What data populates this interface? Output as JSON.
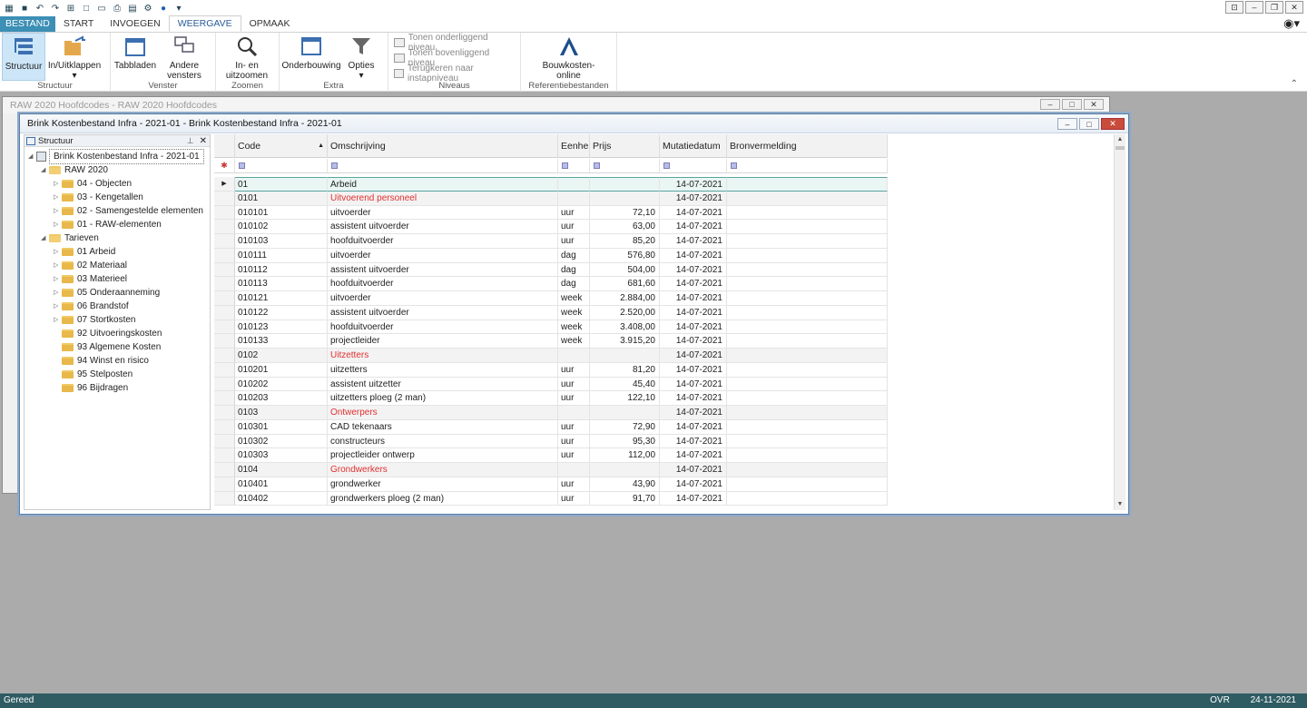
{
  "tabs": {
    "file": "BESTAND",
    "items": [
      "START",
      "INVOEGEN",
      "WEERGAVE",
      "OPMAAK"
    ],
    "active": "WEERGAVE"
  },
  "ribbon": {
    "groups": {
      "structuur": "Structuur",
      "venster": "Venster",
      "zoomen": "Zoomen",
      "extra": "Extra",
      "niveaus": "Niveaus",
      "referentie": "Referentiebestanden"
    },
    "buttons": {
      "structuur": "Structuur",
      "inuitklappen": "In/Uitklappen",
      "tabbladen": "Tabbladen",
      "andere_vensters": "Andere vensters",
      "in_uitzoomen": "In- en uitzoomen",
      "onderbouwing": "Onderbouwing",
      "opties": "Opties",
      "tonen_onder": "Tonen onderliggend niveau",
      "tonen_boven": "Tonen bovenliggend niveau",
      "terugkeren": "Terugkeren naar instapniveau",
      "bouwkosten": "Bouwkosten-online"
    }
  },
  "backwin": {
    "title": "RAW 2020 Hoofdcodes - RAW 2020 Hoofdcodes"
  },
  "frontwin": {
    "title": "Brink Kostenbestand Infra - 2021-01 - Brink Kostenbestand Infra - 2021-01"
  },
  "tree": {
    "header": "Structuur",
    "root": "Brink Kostenbestand Infra - 2021-01",
    "raw": "RAW 2020",
    "raw_children": [
      "04 - Objecten",
      "03 - Kengetallen",
      "02 - Samengestelde elementen",
      "01 - RAW-elementen"
    ],
    "tarieven": "Tarieven",
    "tarieven_children": [
      "01 Arbeid",
      "02 Materiaal",
      "03 Materieel",
      "05 Onderaanneming",
      "06 Brandstof",
      "07 Stortkosten",
      "92 Uitvoeringskosten",
      "93 Algemene Kosten",
      "94 Winst en risico",
      "95 Stelposten",
      "96 Bijdragen"
    ]
  },
  "grid": {
    "columns": [
      "Code",
      "Omschrijving",
      "Eenheid",
      "Prijs",
      "Mutatiedatum",
      "Bronvermelding"
    ],
    "rows": [
      {
        "code": "01",
        "desc": "Arbeid",
        "unit": "",
        "price": "",
        "date": "14-07-2021",
        "type": "selected"
      },
      {
        "code": "0101",
        "desc": "Uitvoerend personeel",
        "unit": "",
        "price": "",
        "date": "14-07-2021",
        "type": "group"
      },
      {
        "code": "010101",
        "desc": "uitvoerder",
        "unit": "uur",
        "price": "72,10",
        "date": "14-07-2021",
        "type": "item"
      },
      {
        "code": "010102",
        "desc": "assistent uitvoerder",
        "unit": "uur",
        "price": "63,00",
        "date": "14-07-2021",
        "type": "item"
      },
      {
        "code": "010103",
        "desc": "hoofduitvoerder",
        "unit": "uur",
        "price": "85,20",
        "date": "14-07-2021",
        "type": "item"
      },
      {
        "code": "010111",
        "desc": "uitvoerder",
        "unit": "dag",
        "price": "576,80",
        "date": "14-07-2021",
        "type": "item"
      },
      {
        "code": "010112",
        "desc": "assistent uitvoerder",
        "unit": "dag",
        "price": "504,00",
        "date": "14-07-2021",
        "type": "item"
      },
      {
        "code": "010113",
        "desc": "hoofduitvoerder",
        "unit": "dag",
        "price": "681,60",
        "date": "14-07-2021",
        "type": "item"
      },
      {
        "code": "010121",
        "desc": "uitvoerder",
        "unit": "week",
        "price": "2.884,00",
        "date": "14-07-2021",
        "type": "item"
      },
      {
        "code": "010122",
        "desc": "assistent uitvoerder",
        "unit": "week",
        "price": "2.520,00",
        "date": "14-07-2021",
        "type": "item"
      },
      {
        "code": "010123",
        "desc": "hoofduitvoerder",
        "unit": "week",
        "price": "3.408,00",
        "date": "14-07-2021",
        "type": "item"
      },
      {
        "code": "010133",
        "desc": "projectleider",
        "unit": "week",
        "price": "3.915,20",
        "date": "14-07-2021",
        "type": "item"
      },
      {
        "code": "0102",
        "desc": "Uitzetters",
        "unit": "",
        "price": "",
        "date": "14-07-2021",
        "type": "group"
      },
      {
        "code": "010201",
        "desc": "uitzetters",
        "unit": "uur",
        "price": "81,20",
        "date": "14-07-2021",
        "type": "item"
      },
      {
        "code": "010202",
        "desc": "assistent uitzetter",
        "unit": "uur",
        "price": "45,40",
        "date": "14-07-2021",
        "type": "item"
      },
      {
        "code": "010203",
        "desc": "uitzetters ploeg (2 man)",
        "unit": "uur",
        "price": "122,10",
        "date": "14-07-2021",
        "type": "item"
      },
      {
        "code": "0103",
        "desc": "Ontwerpers",
        "unit": "",
        "price": "",
        "date": "14-07-2021",
        "type": "group"
      },
      {
        "code": "010301",
        "desc": "CAD tekenaars",
        "unit": "uur",
        "price": "72,90",
        "date": "14-07-2021",
        "type": "item"
      },
      {
        "code": "010302",
        "desc": "constructeurs",
        "unit": "uur",
        "price": "95,30",
        "date": "14-07-2021",
        "type": "item"
      },
      {
        "code": "010303",
        "desc": "projectleider ontwerp",
        "unit": "uur",
        "price": "112,00",
        "date": "14-07-2021",
        "type": "item"
      },
      {
        "code": "0104",
        "desc": "Grondwerkers",
        "unit": "",
        "price": "",
        "date": "14-07-2021",
        "type": "group"
      },
      {
        "code": "010401",
        "desc": "grondwerker",
        "unit": "uur",
        "price": "43,90",
        "date": "14-07-2021",
        "type": "item"
      },
      {
        "code": "010402",
        "desc": "grondwerkers ploeg (2 man)",
        "unit": "uur",
        "price": "91,70",
        "date": "14-07-2021",
        "type": "item"
      }
    ]
  },
  "status": {
    "left": "Gereed",
    "mode": "OVR",
    "date": "24-11-2021"
  },
  "colors": {
    "accent": "#3c8fb5",
    "statusbar": "#2f5b62",
    "group_text": "#e03030"
  }
}
